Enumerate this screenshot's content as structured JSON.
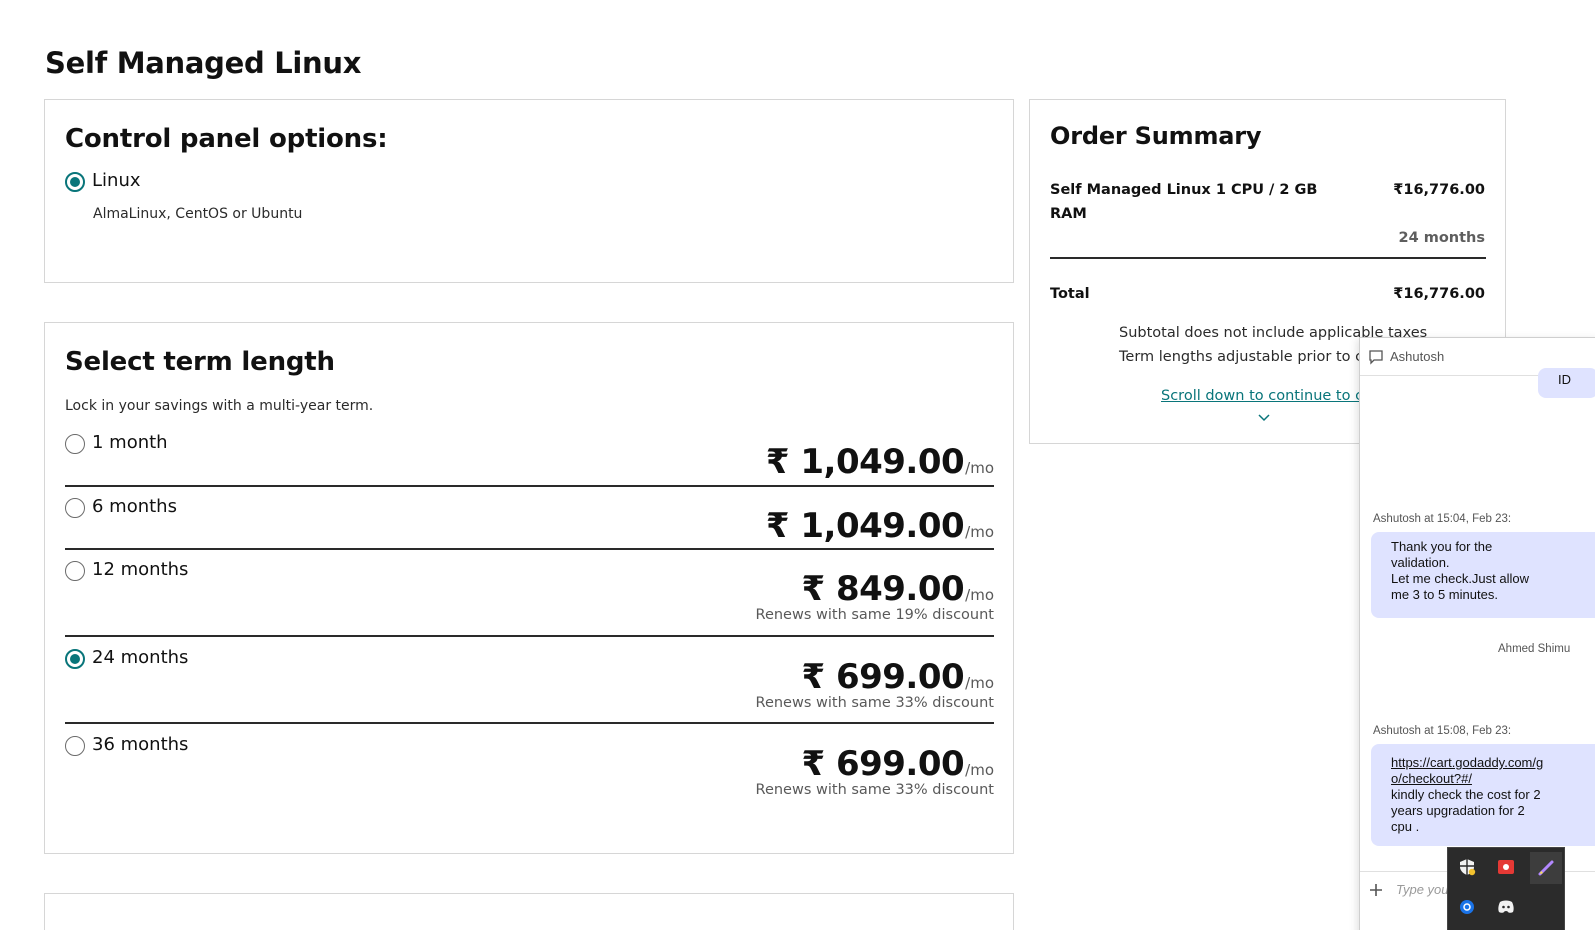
{
  "page": {
    "title": "Self Managed Linux"
  },
  "control_panel": {
    "heading": "Control panel options:",
    "option_label": "Linux",
    "option_desc": "AlmaLinux, CentOS or Ubuntu",
    "selected": true
  },
  "term": {
    "heading": "Select term length",
    "subtitle": "Lock in your savings with a multi-year term.",
    "per_unit": "/mo",
    "options": [
      {
        "label": "1 month",
        "price": "₹ 1,049.00",
        "renew": "",
        "selected": false
      },
      {
        "label": "6 months",
        "price": "₹ 1,049.00",
        "renew": "",
        "selected": false
      },
      {
        "label": "12 months",
        "price": "₹ 849.00",
        "renew": "Renews with same 19% discount",
        "selected": false
      },
      {
        "label": "24 months",
        "price": "₹ 699.00",
        "renew": "Renews with same 33% discount",
        "selected": true
      },
      {
        "label": "36 months",
        "price": "₹ 699.00",
        "renew": "Renews with same 33% discount",
        "selected": false
      }
    ]
  },
  "summary": {
    "heading": "Order Summary",
    "item_name_line1": "Self Managed Linux 1 CPU / 2 GB",
    "item_name_line2": "RAM",
    "item_price": "₹16,776.00",
    "item_term": "24 months",
    "total_label": "Total",
    "total_value": "₹16,776.00",
    "note1": "Subtotal does not include applicable taxes",
    "note2": "Term lengths adjustable prior to ch",
    "scroll_link": "Scroll down to continue to ca"
  },
  "chat": {
    "header_name": "Ashutosh",
    "top_fragment": "ID",
    "messages": [
      {
        "meta": "Ashutosh at 15:04, Feb 23:",
        "lines": [
          "Thank you for the",
          "validation.",
          "Let me check.Just allow",
          "me 3 to 5 minutes."
        ]
      },
      {
        "meta": "Ashutosh at 15:08, Feb 23:",
        "link_line1": "https://cart.godaddy.com/g",
        "link_line2": "o/checkout?#/",
        "lines": [
          "kindly check the cost for 2",
          "years upgradation for 2",
          "cpu ."
        ]
      }
    ],
    "agent_name": "Ahmed Shimu",
    "input_placeholder": "Type you"
  },
  "colors": {
    "accent": "#09757a",
    "bubble": "#dfe3ff"
  }
}
